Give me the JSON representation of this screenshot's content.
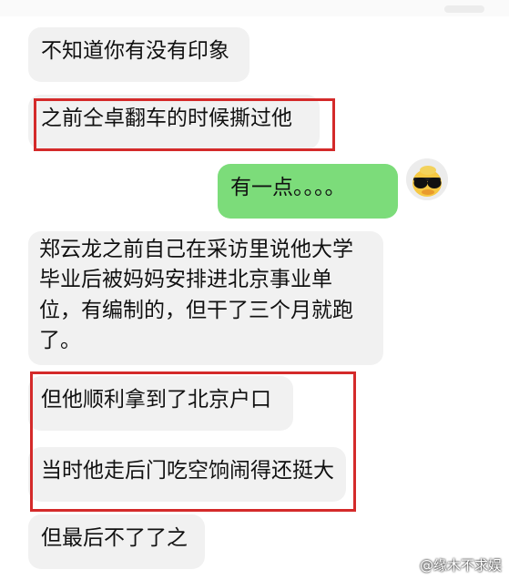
{
  "messages": [
    {
      "text": "不知道你有没有印象",
      "side": "left"
    },
    {
      "text": "之前仝卓翻车的时候撕过他",
      "side": "left"
    },
    {
      "text": "有一点。。。。",
      "side": "right"
    },
    {
      "text": "郑云龙之前自己在采访里说他大学毕业后被妈妈安排进北京事业单位，有编制的，但干了三个月就跑了。",
      "side": "left"
    },
    {
      "text": "但他顺利拿到了北京户口",
      "side": "left"
    },
    {
      "text": "当时他走后门吃空饷闹得还挺大",
      "side": "left"
    },
    {
      "text": "但最后不了了之",
      "side": "left"
    }
  ],
  "watermark": "@缘木不求娱",
  "colors": {
    "incoming_bubble": "#f1f1f1",
    "outgoing_bubble": "#7cdc7a",
    "highlight_box": "#d42a2a"
  }
}
